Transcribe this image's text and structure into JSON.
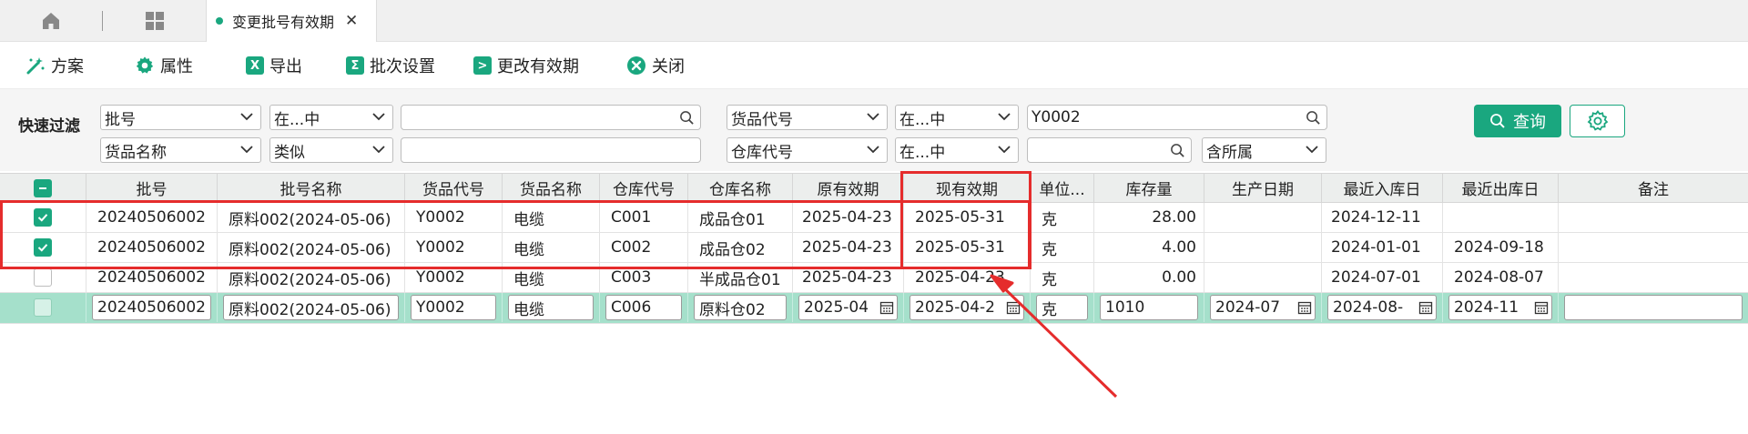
{
  "tabs": {
    "active_label": "变更批号有效期",
    "close_glyph": "✕"
  },
  "toolbar": {
    "plan": "方案",
    "props": "属性",
    "export": "导出",
    "batch": "批次设置",
    "change": "更改有效期",
    "close": "关闭",
    "export_icon_text": "X",
    "batch_icon_text": "Σ",
    "change_icon_text": ">"
  },
  "filter": {
    "label": "快速过滤",
    "row1": {
      "field1": "批号",
      "op1": "在...中",
      "val1": "",
      "field2": "货品代号",
      "op2": "在...中",
      "val2": "Y0002"
    },
    "row2": {
      "field1": "货品名称",
      "op1": "类似",
      "val1": "",
      "field2": "仓库代号",
      "op2": "在...中",
      "val2": "",
      "scope": "含所属"
    },
    "query_button": "查询"
  },
  "grid": {
    "columns": [
      "批号",
      "批号名称",
      "货品代号",
      "货品名称",
      "仓库代号",
      "仓库名称",
      "原有效期",
      "现有效期",
      "单位...",
      "库存量",
      "生产日期",
      "最近入库日",
      "最近出库日",
      "备注"
    ],
    "rows": [
      {
        "checked": true,
        "cells": [
          "20240506002",
          "原料002(2024-05-06)",
          "Y0002",
          "电缆",
          "C001",
          "成品仓01",
          "2025-04-23",
          "2025-05-31",
          "克",
          "28.00",
          "",
          "2024-12-11",
          "",
          ""
        ]
      },
      {
        "checked": true,
        "cells": [
          "20240506002",
          "原料002(2024-05-06)",
          "Y0002",
          "电缆",
          "C002",
          "成品仓02",
          "2025-04-23",
          "2025-05-31",
          "克",
          "4.00",
          "",
          "2024-01-01",
          "2024-09-18",
          ""
        ]
      },
      {
        "checked": false,
        "cells": [
          "20240506002",
          "原料002(2024-05-06)",
          "Y0002",
          "电缆",
          "C003",
          "半成品仓01",
          "2025-04-23",
          "2025-04-23",
          "克",
          "0.00",
          "",
          "2024-07-01",
          "2024-08-07",
          ""
        ]
      }
    ],
    "edit_row": {
      "checked": false,
      "cells": [
        "20240506002",
        "原料002(2024-05-06)",
        "Y0002",
        "电缆",
        "C006",
        "原料仓02",
        "2025-04",
        "2025-04-2",
        "克",
        "1010",
        "2024-07",
        "2024-08-",
        "2024-11",
        ""
      ]
    }
  },
  "colors": {
    "accent": "#1aa77f",
    "highlight": "#e52c2c",
    "edit_row_bg": "#a5e0cb"
  }
}
